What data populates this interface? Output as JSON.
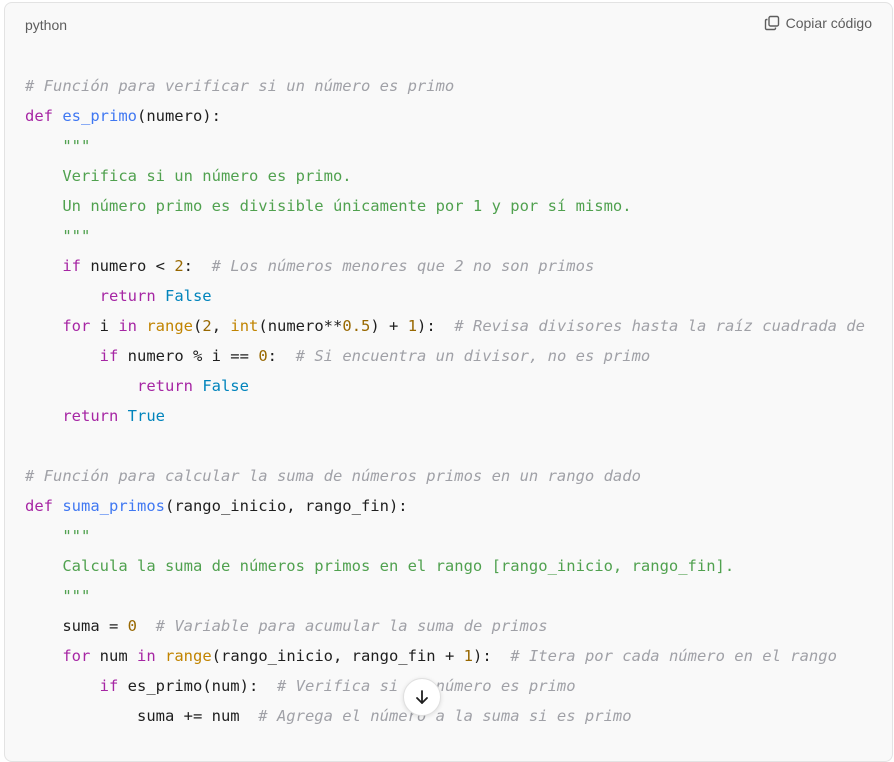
{
  "header": {
    "language": "python",
    "copy_label": "Copiar código"
  },
  "icons": {
    "copy": "copy-icon",
    "scroll_down": "arrow-down-icon"
  },
  "code": {
    "lines": [
      [
        [
          "cm",
          "# Función para verificar si un número es primo"
        ]
      ],
      [
        [
          "kw",
          "def "
        ],
        [
          "fn",
          "es_primo"
        ],
        [
          "pl",
          "(numero):"
        ]
      ],
      [
        [
          "pl",
          "    "
        ],
        [
          "st",
          "\"\"\""
        ]
      ],
      [
        [
          "pl",
          "    "
        ],
        [
          "st",
          "Verifica si un número es primo."
        ]
      ],
      [
        [
          "pl",
          "    "
        ],
        [
          "st",
          "Un número primo es divisible únicamente por 1 y por sí mismo."
        ]
      ],
      [
        [
          "pl",
          "    "
        ],
        [
          "st",
          "\"\"\""
        ]
      ],
      [
        [
          "pl",
          "    "
        ],
        [
          "kw",
          "if"
        ],
        [
          "pl",
          " numero < "
        ],
        [
          "nu",
          "2"
        ],
        [
          "pl",
          ":  "
        ],
        [
          "cm",
          "# Los números menores que 2 no son primos"
        ]
      ],
      [
        [
          "pl",
          "        "
        ],
        [
          "kw",
          "return "
        ],
        [
          "bo",
          "False"
        ]
      ],
      [
        [
          "pl",
          "    "
        ],
        [
          "kw",
          "for"
        ],
        [
          "pl",
          " i "
        ],
        [
          "kw",
          "in "
        ],
        [
          "bi",
          "range"
        ],
        [
          "pl",
          "("
        ],
        [
          "nu",
          "2"
        ],
        [
          "pl",
          ", "
        ],
        [
          "bi",
          "int"
        ],
        [
          "pl",
          "(numero**"
        ],
        [
          "nu",
          "0.5"
        ],
        [
          "pl",
          ") + "
        ],
        [
          "nu",
          "1"
        ],
        [
          "pl",
          "):  "
        ],
        [
          "cm",
          "# Revisa divisores hasta la raíz cuadrada de"
        ]
      ],
      [
        [
          "pl",
          "        "
        ],
        [
          "kw",
          "if"
        ],
        [
          "pl",
          " numero % i == "
        ],
        [
          "nu",
          "0"
        ],
        [
          "pl",
          ":  "
        ],
        [
          "cm",
          "# Si encuentra un divisor, no es primo"
        ]
      ],
      [
        [
          "pl",
          "            "
        ],
        [
          "kw",
          "return "
        ],
        [
          "bo",
          "False"
        ]
      ],
      [
        [
          "pl",
          "    "
        ],
        [
          "kw",
          "return "
        ],
        [
          "bo",
          "True"
        ]
      ],
      [
        [
          "pl",
          ""
        ]
      ],
      [
        [
          "cm",
          "# Función para calcular la suma de números primos en un rango dado"
        ]
      ],
      [
        [
          "kw",
          "def "
        ],
        [
          "fn",
          "suma_primos"
        ],
        [
          "pl",
          "(rango_inicio, rango_fin):"
        ]
      ],
      [
        [
          "pl",
          "    "
        ],
        [
          "st",
          "\"\"\""
        ]
      ],
      [
        [
          "pl",
          "    "
        ],
        [
          "st",
          "Calcula la suma de números primos en el rango [rango_inicio, rango_fin]."
        ]
      ],
      [
        [
          "pl",
          "    "
        ],
        [
          "st",
          "\"\"\""
        ]
      ],
      [
        [
          "pl",
          "    suma = "
        ],
        [
          "nu",
          "0"
        ],
        [
          "pl",
          "  "
        ],
        [
          "cm",
          "# Variable para acumular la suma de primos"
        ]
      ],
      [
        [
          "pl",
          "    "
        ],
        [
          "kw",
          "for"
        ],
        [
          "pl",
          " num "
        ],
        [
          "kw",
          "in "
        ],
        [
          "bi",
          "range"
        ],
        [
          "pl",
          "(rango_inicio, rango_fin + "
        ],
        [
          "nu",
          "1"
        ],
        [
          "pl",
          "):  "
        ],
        [
          "cm",
          "# Itera por cada número en el rango"
        ]
      ],
      [
        [
          "pl",
          "        "
        ],
        [
          "kw",
          "if"
        ],
        [
          "pl",
          " es_primo(num):  "
        ],
        [
          "cm",
          "# Verifica si el número es primo"
        ]
      ],
      [
        [
          "pl",
          "            suma += num  "
        ],
        [
          "cm",
          "# Agrega el número a la suma si es primo"
        ]
      ]
    ]
  }
}
